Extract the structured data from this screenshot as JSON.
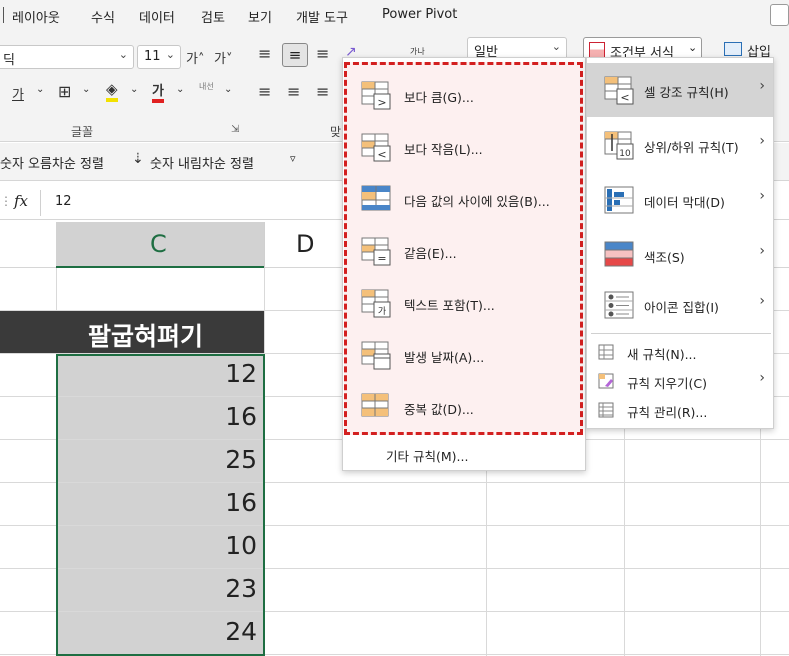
{
  "menubar": {
    "items": [
      "레이아웃",
      "수식",
      "데이터",
      "검토",
      "보기",
      "개발 도구",
      "Power Pivot"
    ]
  },
  "ribbon": {
    "font_name": "딕",
    "font_size": "11",
    "grow_font": "가˄",
    "shrink_font": "가˅",
    "number_format": "일반",
    "font_group_label": "글꼴",
    "cond_format_label": "조건부 서식",
    "insert_label": "삽입",
    "wrap_label": "가나",
    "direction_label": "내선"
  },
  "sortbar": {
    "asc_label": "숫자 오름차순 정렬",
    "desc_label": "숫자 내림차순 정렬"
  },
  "formula": {
    "fx": "fx",
    "value": "12"
  },
  "columns": {
    "c": "C",
    "d": "D"
  },
  "sheet": {
    "header": "팔굽혀펴기",
    "values": [
      "12",
      "16",
      "25",
      "16",
      "10",
      "23",
      "24"
    ]
  },
  "submenu": {
    "items": [
      "보다 큼(G)...",
      "보다 작음(L)...",
      "다음 값의 사이에 있음(B)...",
      "같음(E)...",
      "텍스트 포함(T)...",
      "발생 날짜(A)...",
      "중복 값(D)..."
    ],
    "other": "기타 규칙(M)..."
  },
  "mainmenu": {
    "items": [
      "셀 강조 규칙(H)",
      "상위/하위 규칙(T)",
      "데이터 막대(D)",
      "색조(S)",
      "아이콘 집합(I)"
    ],
    "small_items": [
      "새 규칙(N)...",
      "규칙 지우기(C)",
      "규칙 관리(R)..."
    ],
    "icon_badge": "10"
  },
  "colors": {
    "accent": "#1e6e42",
    "dash": "#d32020",
    "header_fill": "#3a3a3a",
    "selection_fill": "#d2d2d2"
  }
}
